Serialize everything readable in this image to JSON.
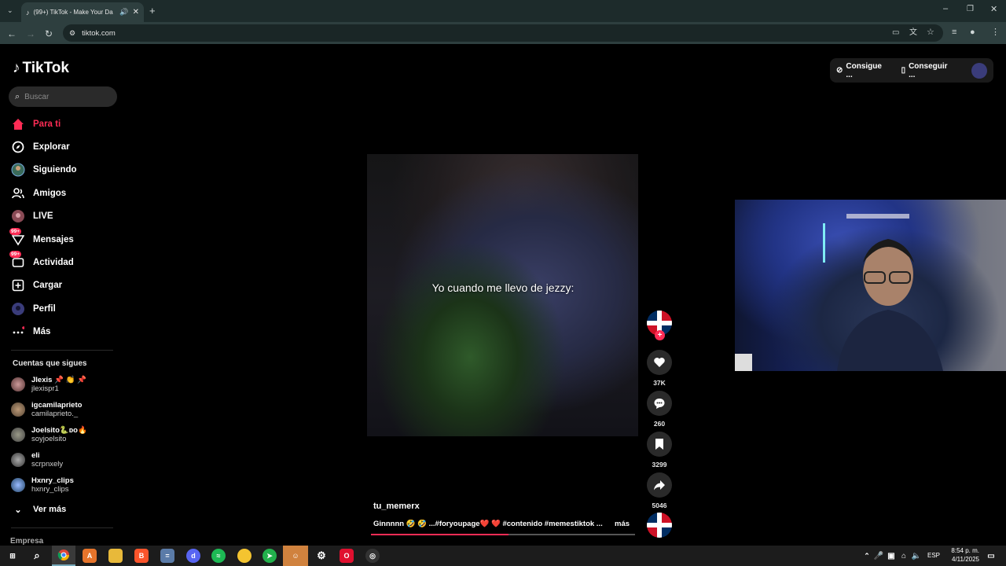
{
  "browser": {
    "tab_title": "(99+) TikTok - Make Your Da",
    "url": "tiktok.com"
  },
  "sidebar": {
    "logo": "TikTok",
    "search_placeholder": "Buscar",
    "nav": [
      {
        "label": "Para ti",
        "icon": "home-icon",
        "active": true
      },
      {
        "label": "Explorar",
        "icon": "compass-icon"
      },
      {
        "label": "Siguiendo",
        "icon": "following-icon"
      },
      {
        "label": "Amigos",
        "icon": "friends-icon"
      },
      {
        "label": "LIVE",
        "icon": "live-icon"
      },
      {
        "label": "Mensajes",
        "icon": "messages-icon",
        "badge": "99+"
      },
      {
        "label": "Actividad",
        "icon": "activity-icon",
        "badge": "99+"
      },
      {
        "label": "Cargar",
        "icon": "upload-icon"
      },
      {
        "label": "Perfil",
        "icon": "profile-icon"
      },
      {
        "label": "Más",
        "icon": "more-icon"
      }
    ],
    "following_title": "Cuentas que sigues",
    "following": [
      {
        "name": "Jlexis 📌 👏 📌",
        "handle": "jlexispr1"
      },
      {
        "name": "igcamilaprieto",
        "handle": "camilaprieto._"
      },
      {
        "name": "Joelsito🐍ᴅᴏ🔥",
        "handle": "soyjoelsito"
      },
      {
        "name": "eli",
        "handle": "scrpnxely"
      },
      {
        "name": "Hxnry_clips",
        "handle": "hxnry_clips"
      }
    ],
    "see_more": "Ver más",
    "footer": "Empresa"
  },
  "header": {
    "button1": "Consigue ...",
    "button2": "Conseguir ..."
  },
  "video": {
    "caption": "Yo cuando me llevo de jezzy:",
    "author": "tu_memerx",
    "description": "Ginnnnn 🤣 🤣 ...#foryoupage❤️ ❤️ #contenido #memestiktok ...",
    "more_label": "más",
    "likes": "37K",
    "comments": "260",
    "saves": "3299",
    "shares": "5046",
    "progress": 0.52
  },
  "taskbar": {
    "language": "ESP",
    "time": "8:54 p. m.",
    "date": "4/11/2025"
  },
  "colors": {
    "accent": "#fe2c55",
    "chrome_dark": "#1d2b2b",
    "chrome_bar": "#2e3f3f"
  }
}
